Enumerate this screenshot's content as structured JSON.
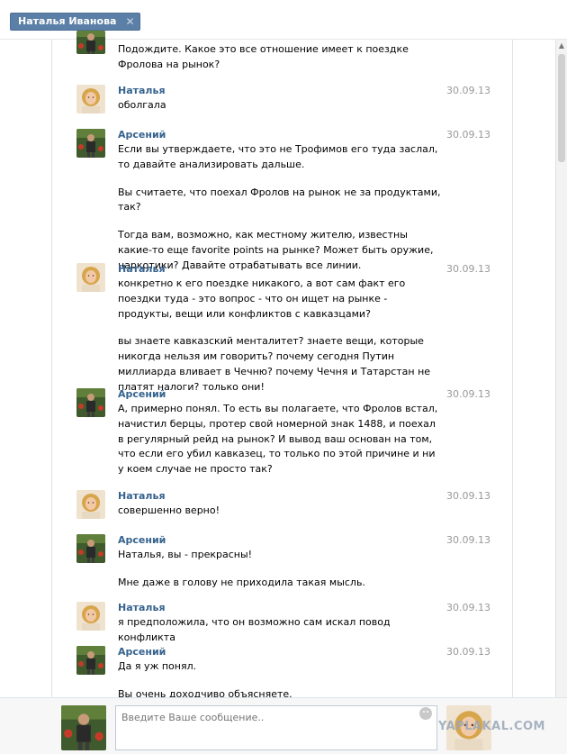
{
  "tab": {
    "label": "Наталья Иванова",
    "close_glyph": "✕"
  },
  "messages": [
    {
      "sender": "",
      "date": "",
      "avatar": "arseny-avatar",
      "paragraphs": [
        "Подождите. Какое это все отношение имеет к поездке Фролова на рынок?"
      ]
    },
    {
      "sender": "Наталья",
      "date": "30.09.13",
      "avatar": "natalya-avatar",
      "paragraphs": [
        "оболгала"
      ]
    },
    {
      "sender": "Арсений",
      "date": "30.09.13",
      "avatar": "arseny-avatar",
      "paragraphs": [
        "Если вы утверждаете, что это не Трофимов его туда заслал, то давайте анализировать дальше.",
        "Вы считаете, что поехал Фролов на рынок не за продуктами, так?",
        "Тогда вам, возможно, как местному жителю, известны какие-то еще favorite points на рынке? Может быть оружие, наркотики? Давайте отрабатывать все линии."
      ]
    },
    {
      "sender": "Наталья",
      "date": "30.09.13",
      "avatar": "natalya-avatar",
      "paragraphs": [
        "конкретно к его поездке никакого, а вот сам факт его поездки туда - это вопрос - что он ищет на рынке - продукты, вещи или конфликтов с кавказцами?",
        "вы знаете кавказский менталитет? знаете вещи, которые никогда нельзя им говорить? почему сегодня Путин миллиарда вливает в Чечню? почему Чечня и Татарстан не платят налоги? только они!"
      ]
    },
    {
      "sender": "Арсений",
      "date": "30.09.13",
      "avatar": "arseny-avatar",
      "paragraphs": [
        "А, примерно понял. То есть вы полагаете, что Фролов встал, начистил берцы, протер свой номерной знак 1488, и поехал в регулярный рейд на рынок? И вывод ваш основан на том, что если его убил кавказец, то только по этой причине и ни у коем случае не просто так?"
      ]
    },
    {
      "sender": "Наталья",
      "date": "30.09.13",
      "avatar": "natalya-avatar",
      "paragraphs": [
        "совершенно верно!"
      ]
    },
    {
      "sender": "Арсений",
      "date": "30.09.13",
      "avatar": "arseny-avatar",
      "paragraphs": [
        "Наталья, вы - прекрасны!",
        "Мне даже в голову не приходила такая мысль."
      ]
    },
    {
      "sender": "Наталья",
      "date": "30.09.13",
      "avatar": "natalya-avatar",
      "paragraphs": [
        "я предположила, что он возможно сам искал повод конфликта"
      ]
    },
    {
      "sender": "Арсений",
      "date": "30.09.13",
      "avatar": "arseny-avatar",
      "paragraphs": [
        "Да я уж понял.",
        "Вы очень доходчиво объясняете."
      ]
    }
  ],
  "composer": {
    "placeholder": "Введите Ваше сообщение.."
  },
  "watermark": "YAPLAKAL.COM",
  "colors": {
    "accent": "#36638e",
    "tab_bg": "#5b7fa6",
    "date": "#999999"
  }
}
